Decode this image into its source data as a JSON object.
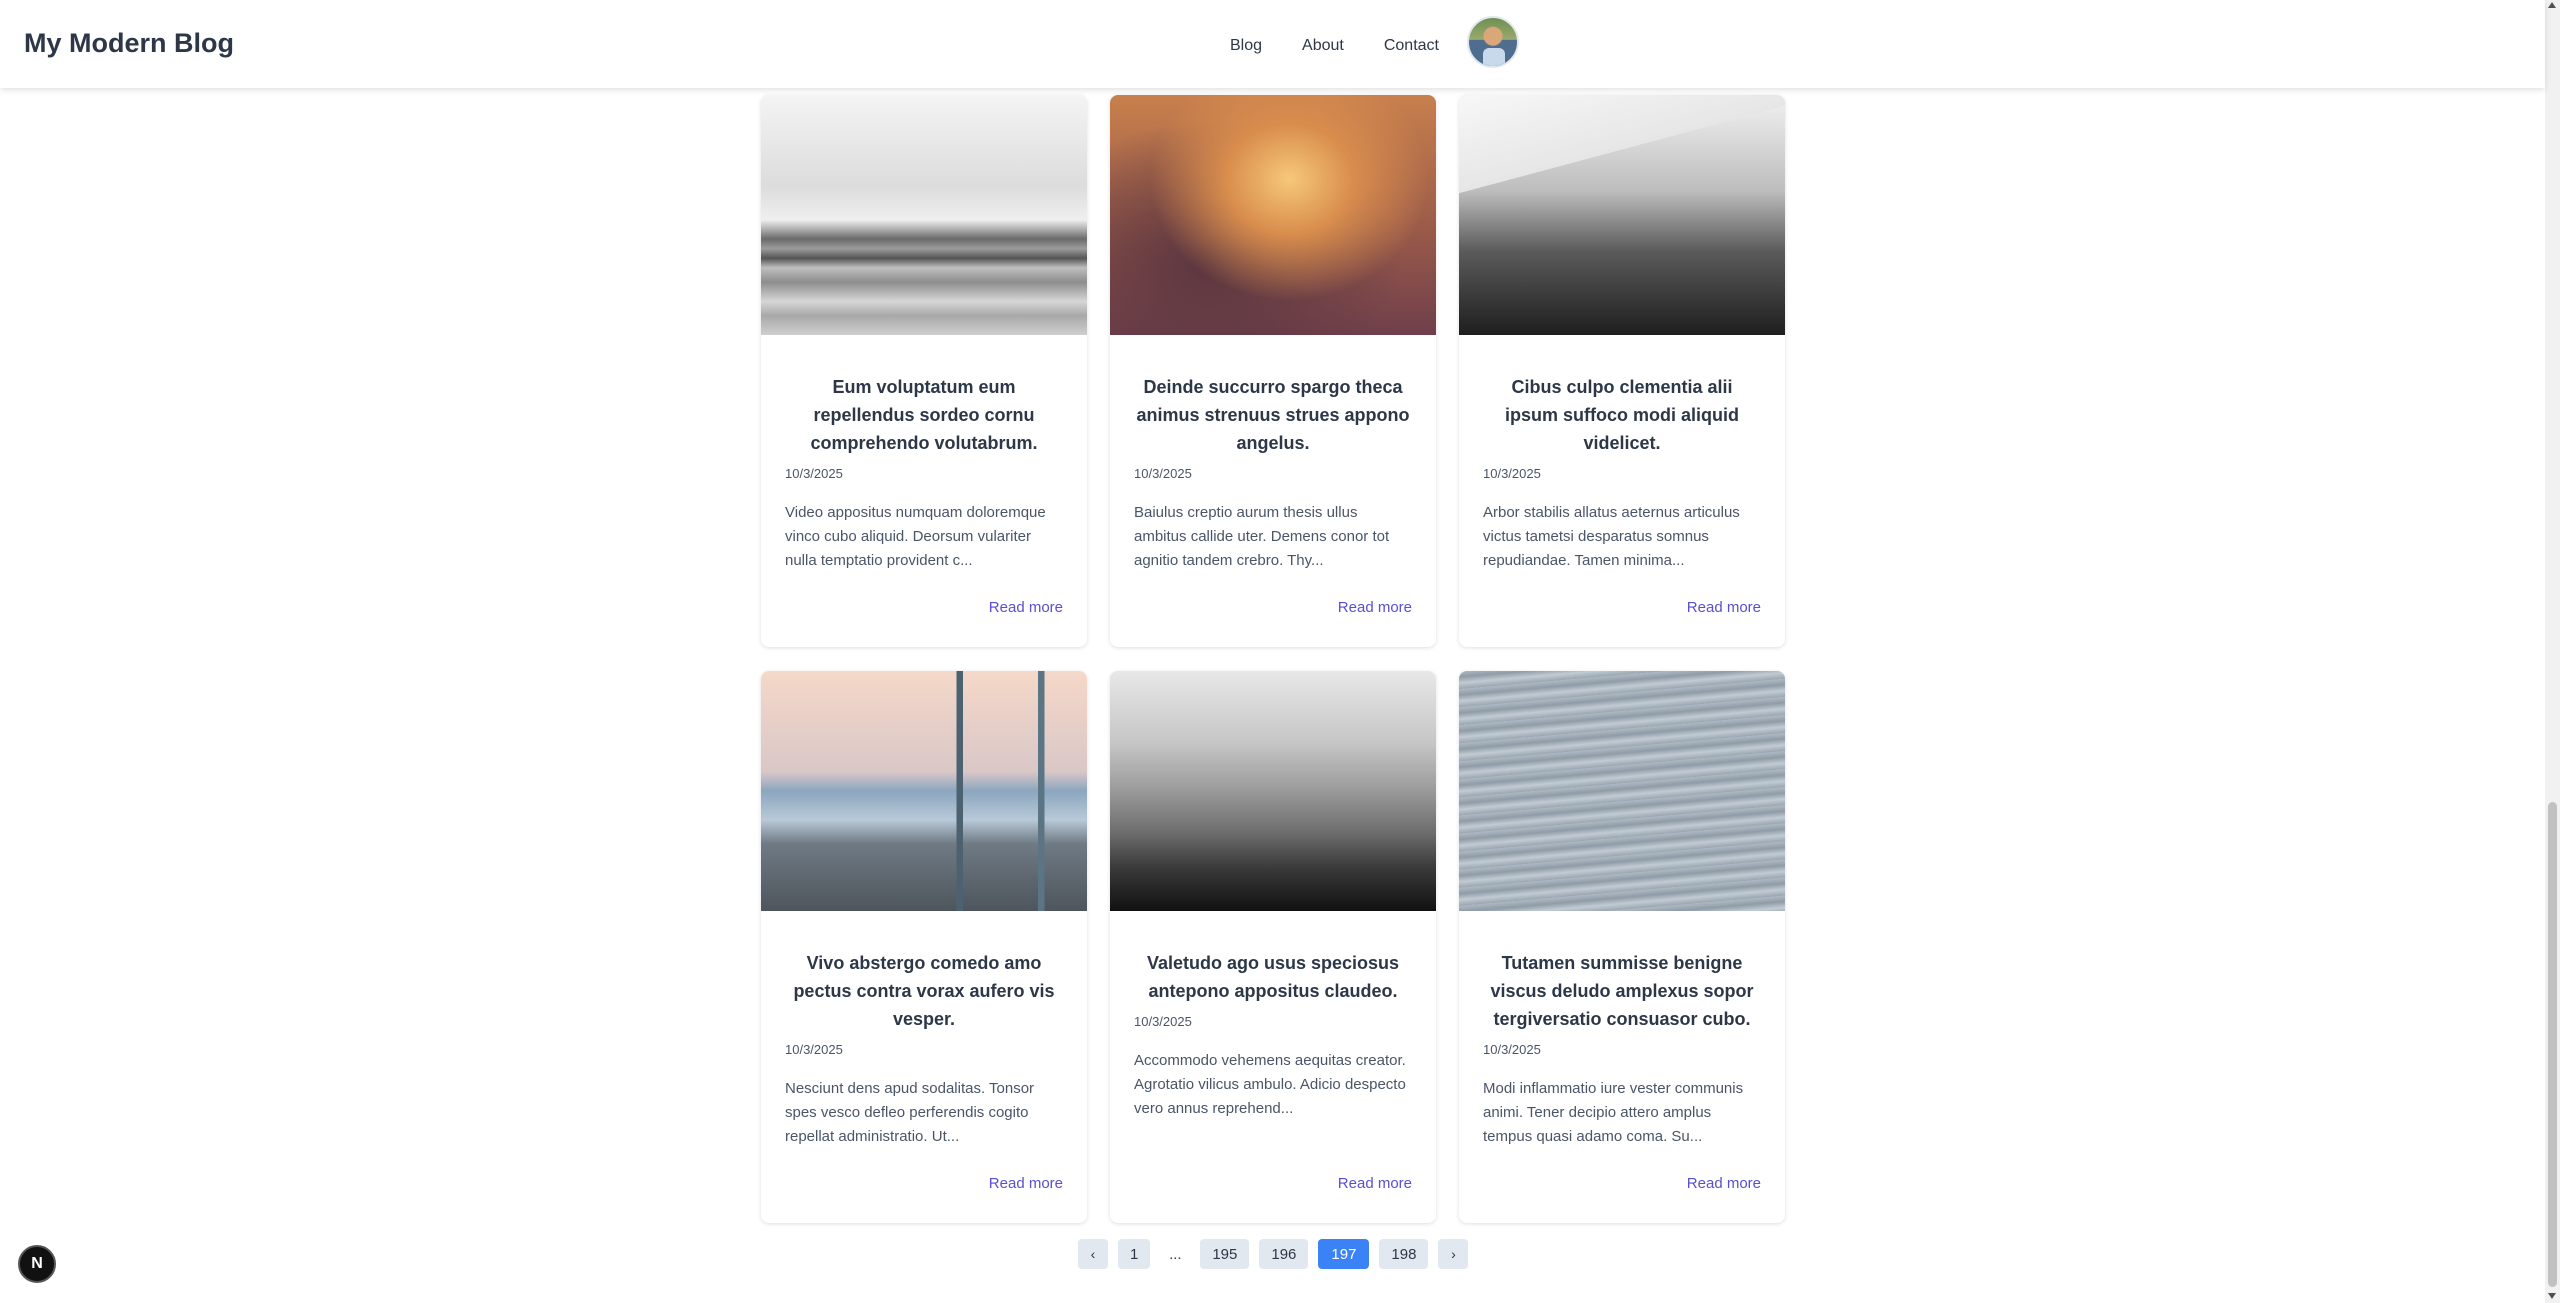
{
  "header": {
    "title": "My Modern Blog",
    "nav": [
      {
        "label": "Blog"
      },
      {
        "label": "About"
      },
      {
        "label": "Contact"
      }
    ]
  },
  "posts": [
    {
      "title": "Eum voluptatum eum repellendus sordeo cornu comprehendo volutabrum.",
      "date": "10/3/2025",
      "excerpt": "Video appositus numquam doloremque vinco cubo aliquid. Deorsum vulariter nulla temptatio provident c...",
      "link": "Read more"
    },
    {
      "title": "Deinde succurro spargo theca animus strenuus strues appono angelus.",
      "date": "10/3/2025",
      "excerpt": "Baiulus creptio aurum thesis ullus ambitus callide uter. Demens conor tot agnitio tandem crebro. Thy...",
      "link": "Read more"
    },
    {
      "title": "Cibus culpo clementia alii ipsum suffoco modi aliquid videlicet.",
      "date": "10/3/2025",
      "excerpt": "Arbor stabilis allatus aeternus articulus victus tametsi desparatus somnus repudiandae. Tamen minima...",
      "link": "Read more"
    },
    {
      "title": "Vivo abstergo comedo amo pectus contra vorax aufero vis vesper.",
      "date": "10/3/2025",
      "excerpt": "Nesciunt dens apud sodalitas. Tonsor spes vesco defleo perferendis cogito repellat administratio. Ut...",
      "link": "Read more"
    },
    {
      "title": "Valetudo ago usus speciosus antepono appositus claudeo.",
      "date": "10/3/2025",
      "excerpt": "Accommodo vehemens aequitas creator. Agrotatio vilicus ambulo. Adicio despecto vero annus reprehend...",
      "link": "Read more"
    },
    {
      "title": "Tutamen summisse benigne viscus deludo amplexus sopor tergiversatio consuasor cubo.",
      "date": "10/3/2025",
      "excerpt": "Modi inflammatio iure vester communis animi. Tener decipio attero amplus tempus quasi adamo coma. Su...",
      "link": "Read more"
    }
  ],
  "pagination": {
    "prev": "‹",
    "first": "1",
    "ellipsis": "...",
    "pages": [
      "195",
      "196",
      "197",
      "198"
    ],
    "current": "197",
    "next": "›"
  },
  "badge": {
    "label": "N"
  }
}
